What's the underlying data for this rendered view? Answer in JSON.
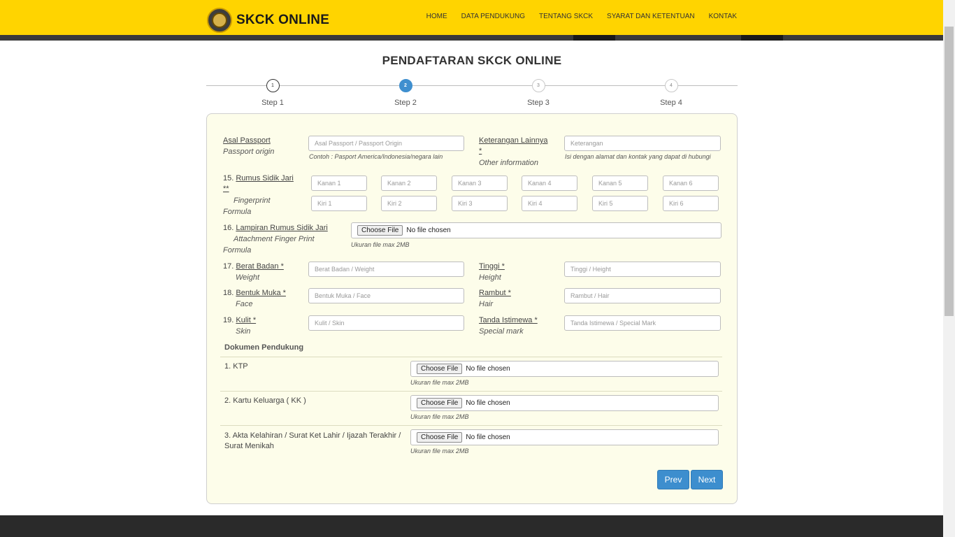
{
  "header": {
    "logo_text": "SKCK ONLINE",
    "nav": [
      "HOME",
      "DATA PENDUKUNG",
      "TENTANG SKCK",
      "SYARAT DAN KETENTUAN",
      "KONTAK"
    ]
  },
  "page_title": "PENDAFTARAN SKCK ONLINE",
  "steps": [
    {
      "num": "1",
      "label": "Step 1"
    },
    {
      "num": "2",
      "label": "Step 2"
    },
    {
      "num": "3",
      "label": "Step 3"
    },
    {
      "num": "4",
      "label": "Step 4"
    }
  ],
  "form": {
    "asal_passport": {
      "label": "Asal Passport",
      "en": "Passport origin",
      "placeholder": "Asal Passport / Passport Origin",
      "hint": "Contoh : Pasport America/Indonesia/negara lain"
    },
    "keterangan": {
      "label": "Keterangan Lainnya",
      "req": "*",
      "en": "Other information",
      "placeholder": "Keterangan",
      "hint": "Isi dengan alamat dan kontak yang dapat di hubungi"
    },
    "rumus": {
      "num": "15.",
      "label": "Rumus Sidik Jari",
      "req": "**",
      "en1": "Fingerprint",
      "en2": "Formula",
      "kanan": [
        "Kanan 1",
        "Kanan 2",
        "Kanan 3",
        "Kanan 4",
        "Kanan 5",
        "Kanan 6"
      ],
      "kiri": [
        "Kiri 1",
        "Kiri 2",
        "Kiri 3",
        "Kiri 4",
        "Kiri 5",
        "Kiri 6"
      ]
    },
    "lampiran": {
      "num": "16.",
      "label": "Lampiran Rumus Sidik Jari",
      "en1": "Attachment Finger Print",
      "en2": "Formula",
      "hint": "Ukuran file max 2MB"
    },
    "berat": {
      "num": "17.",
      "label": "Berat Badan *",
      "en": "Weight",
      "placeholder": "Berat Badan / Weight"
    },
    "tinggi": {
      "label": "Tinggi *",
      "en": "Height",
      "placeholder": "Tinggi / Height"
    },
    "muka": {
      "num": "18.",
      "label": "Bentuk Muka *",
      "en": "Face",
      "placeholder": "Bentuk Muka / Face"
    },
    "rambut": {
      "label": "Rambut *",
      "en": "Hair",
      "placeholder": "Rambut / Hair"
    },
    "kulit": {
      "num": "19.",
      "label": "Kulit *",
      "en": "Skin",
      "placeholder": "Kulit / Skin"
    },
    "tanda": {
      "label": "Tanda Istimewa *",
      "en": "Special mark",
      "placeholder": "Tanda Istimewa / Special Mark"
    },
    "file_button": "Choose File",
    "file_status": "No file chosen"
  },
  "dokumen": {
    "title": "Dokumen Pendukung",
    "items": [
      {
        "label": "1. KTP",
        "hint": "Ukuran file max 2MB"
      },
      {
        "label": "2. Kartu Keluarga ( KK )",
        "hint": "Ukuran file max 2MB"
      },
      {
        "label": "3. Akta Kelahiran / Surat Ket Lahir / Ijazah Terakhir / Surat Menikah",
        "hint": "Ukuran file max 2MB"
      }
    ]
  },
  "buttons": {
    "prev": "Prev",
    "next": "Next"
  },
  "colors": {
    "header": "#ffd400",
    "accent": "#3d8ece",
    "panel": "#fdfdea"
  }
}
